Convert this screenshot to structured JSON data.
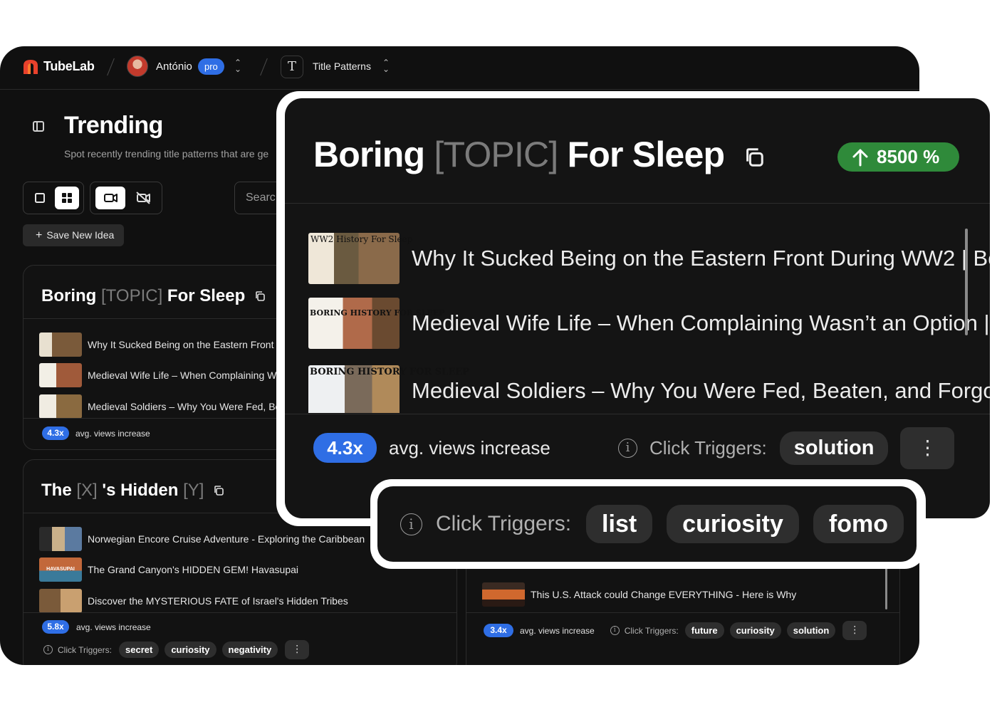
{
  "topbar": {
    "brand": "TubeLab",
    "user_name": "António",
    "plan_badge": "pro",
    "section_icon": "T",
    "section": "Title Patterns"
  },
  "page": {
    "title": "Trending",
    "subtitle": "Spot recently trending title patterns that are ge",
    "search_placeholder": "Searc",
    "save_button": "Save New Idea"
  },
  "cards": [
    {
      "title_parts": [
        "Boring",
        "[TOPIC]",
        "For Sleep"
      ],
      "videos": [
        "Why It Sucked Being on the Eastern Front",
        "Medieval Wife Life – When Complaining W",
        "Medieval Soldiers – Why You Were Fed, Be"
      ],
      "views_increase": "4.3x",
      "views_label": "avg. views increase"
    },
    {
      "title_parts": [
        "The",
        "[X]",
        "'s Hidden",
        "[Y]"
      ],
      "videos": [
        "Norwegian Encore Cruise Adventure - Exploring the Caribbean",
        "The Grand Canyon's HIDDEN GEM! Havasupai",
        "Discover the MYSTERIOUS FATE of Israel's Hidden Tribes"
      ],
      "views_increase": "5.8x",
      "views_label": "avg. views increase",
      "triggers_label": "Click Triggers:",
      "triggers": [
        "secret",
        "curiosity",
        "negativity"
      ]
    },
    {
      "videos": [
        "This U.S. Attack could Change EVERYTHING - Here is Why"
      ],
      "views_increase": "3.4x",
      "views_label": "avg. views increase",
      "triggers_label": "Click Triggers:",
      "triggers": [
        "future",
        "curiosity",
        "solution"
      ]
    }
  ],
  "zoom": {
    "title_parts": [
      "Boring",
      "[TOPIC]",
      "For Sleep"
    ],
    "growth": "8500 %",
    "videos": [
      "Why It Sucked Being on the Eastern Front During WW2 | Bo",
      "Medieval Wife Life – When Complaining Wasn’t an Option |",
      "Medieval Soldiers – Why You Were Fed, Beaten, and Forgo"
    ],
    "views_increase": "4.3x",
    "views_label": "avg. views increase",
    "triggers_label": "Click Triggers:",
    "triggers": [
      "solution"
    ]
  },
  "zoom2": {
    "triggers_label": "Click Triggers:",
    "triggers": [
      "list",
      "curiosity",
      "fomo"
    ]
  },
  "thumbnails": {
    "ww2": "WW2 History For Sleep",
    "boring": "BORING HISTORY FOR SLEEP",
    "havasupai": "HAVASUPAI"
  },
  "colors": {
    "accent_blue": "#2f6ee5",
    "growth_green": "#2f8a3a",
    "brand_red": "#e8412c"
  }
}
